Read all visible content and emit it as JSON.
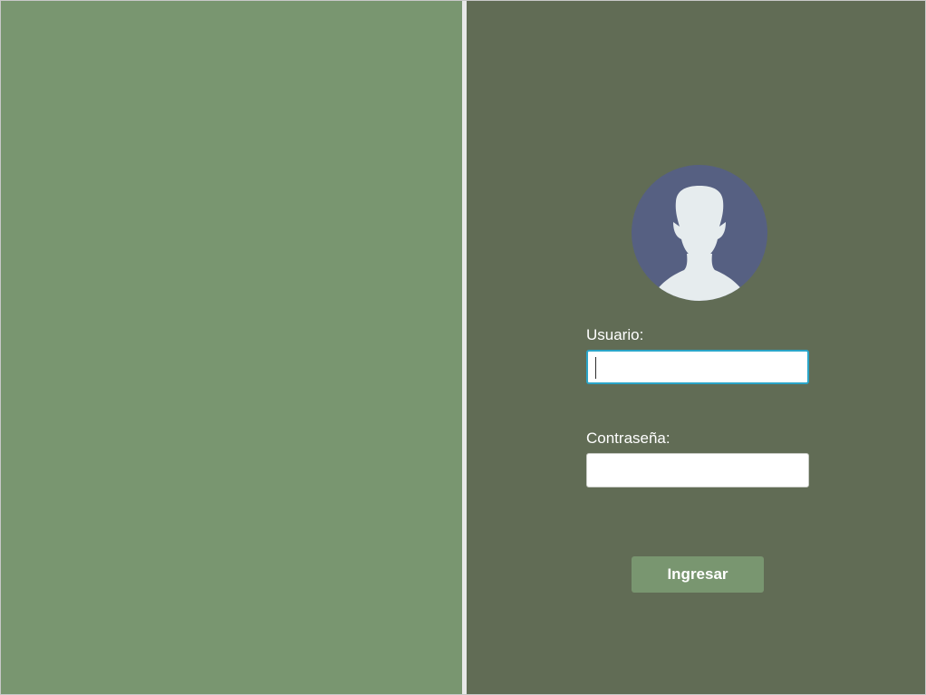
{
  "login": {
    "avatar_icon": "user-silhouette-icon",
    "username_label": "Usuario:",
    "username_value": "",
    "password_label": "Contraseña:",
    "password_value": "",
    "submit_label": "Ingresar"
  },
  "colors": {
    "left_panel": "#799670",
    "right_panel": "#616c55",
    "avatar_circle": "#566082",
    "avatar_figure": "#e6ecee",
    "button": "#799670",
    "focus_border": "#2aa5c8"
  }
}
